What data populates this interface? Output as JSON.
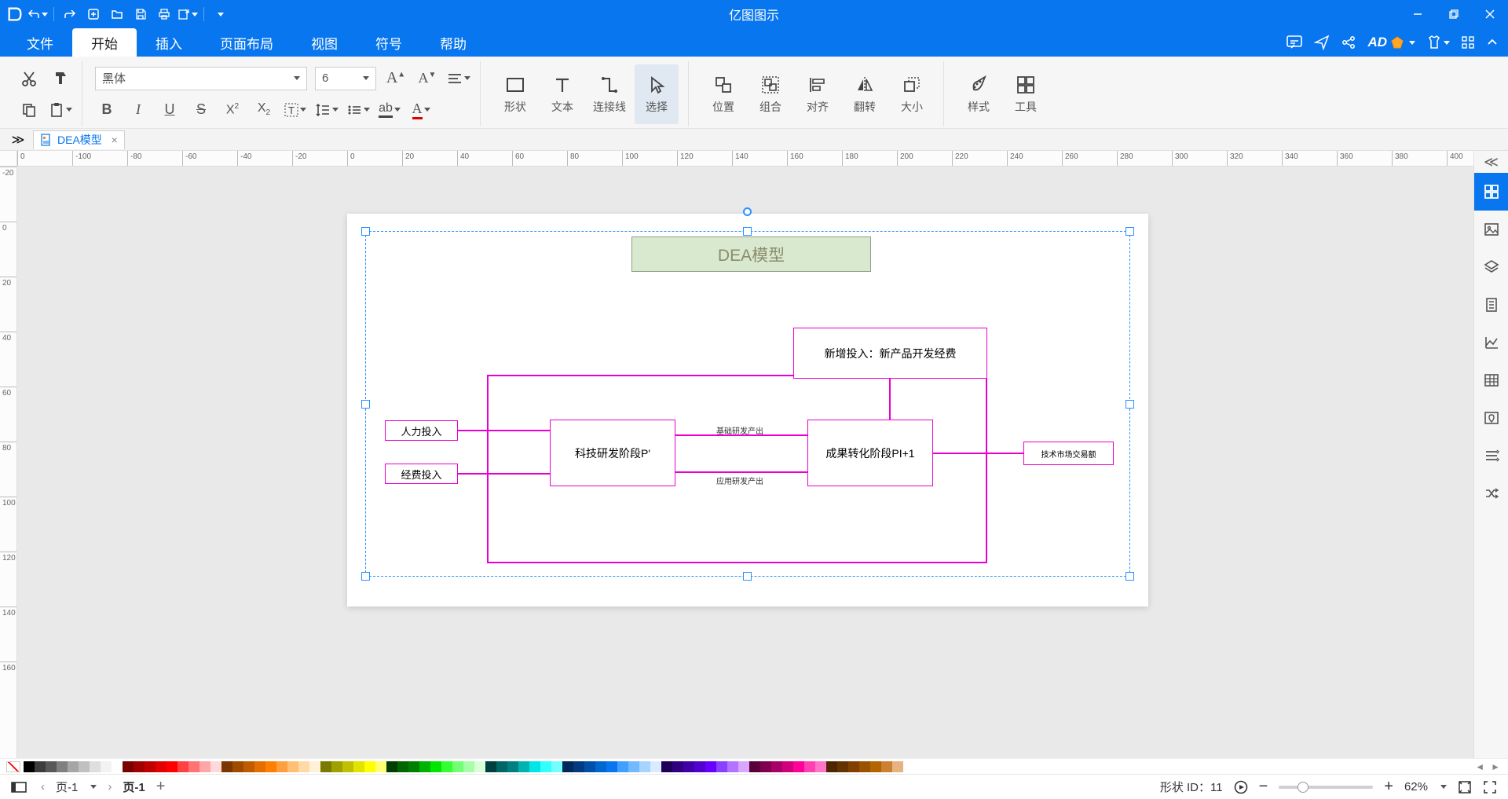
{
  "app": {
    "name": "亿图图示"
  },
  "menu": {
    "tabs": [
      "文件",
      "开始",
      "插入",
      "页面布局",
      "视图",
      "符号",
      "帮助"
    ],
    "active": 1,
    "ad": "AD"
  },
  "ribbon": {
    "font": "黑体",
    "size": "6",
    "groups": {
      "shape": "形状",
      "text": "文本",
      "connector": "连接线",
      "select": "选择",
      "position": "位置",
      "group": "组合",
      "align": "对齐",
      "flip": "翻转",
      "sizegrp": "大小",
      "style": "样式",
      "tools": "工具"
    }
  },
  "doctab": {
    "name": "DEA模型"
  },
  "hruler": [
    "0",
    "-100",
    "-80",
    "-60",
    "-40",
    "-20",
    "0",
    "20",
    "40",
    "60",
    "80",
    "100",
    "120",
    "140",
    "160",
    "180",
    "200",
    "220",
    "240",
    "260",
    "280",
    "300",
    "320",
    "340",
    "360",
    "380",
    "400"
  ],
  "vruler": [
    "-20",
    "0",
    "20",
    "40",
    "60",
    "80",
    "100",
    "120",
    "140",
    "160"
  ],
  "flow": {
    "title": "DEA模型",
    "in1": "人力投入",
    "in2": "经费投入",
    "stage1": "科技研发阶段P'",
    "stage2": "成果转化阶段PI+1",
    "top": "新增投入：新产品开发经费",
    "out": "技术市场交易额",
    "lab1": "基础研发产出",
    "lab2": "应用研发产出"
  },
  "rightpanel_icons": [
    "grid",
    "image",
    "layers",
    "page",
    "chart",
    "table",
    "map",
    "list",
    "shuffle"
  ],
  "status": {
    "page_label": "页-1",
    "page_active": "页-1",
    "shape": "形状 ID：",
    "shape_id": "11",
    "zoom": "62%"
  },
  "colors": [
    "#000000",
    "#3d3d3d",
    "#595959",
    "#808080",
    "#a6a6a6",
    "#c0c0c0",
    "#dedede",
    "#f2f2f2",
    "#ffffff",
    "#7a0000",
    "#a00000",
    "#c00000",
    "#e30000",
    "#ff0000",
    "#ff4040",
    "#ff7373",
    "#ffa6a6",
    "#ffd9d9",
    "#7a3800",
    "#a04a00",
    "#c05c00",
    "#e36f00",
    "#ff8000",
    "#ffa040",
    "#ffc073",
    "#ffd9a6",
    "#fff0d9",
    "#7a7a00",
    "#a0a000",
    "#c0c000",
    "#e3e300",
    "#ffff00",
    "#ffff73",
    "#003f00",
    "#006600",
    "#008000",
    "#00b300",
    "#00e600",
    "#33ff33",
    "#73ff73",
    "#a6ffa6",
    "#d9ffd9",
    "#004040",
    "#006666",
    "#008080",
    "#00b3b3",
    "#00e6e6",
    "#33ffff",
    "#73ffff",
    "#002859",
    "#003a80",
    "#0050a8",
    "#0066d0",
    "#0876ee",
    "#409fff",
    "#73b9ff",
    "#a6d3ff",
    "#d9ecff",
    "#1f0059",
    "#300080",
    "#4000a8",
    "#5200d0",
    "#6600ff",
    "#8c40ff",
    "#b273ff",
    "#d8a6ff",
    "#59003a",
    "#80004f",
    "#a80066",
    "#d0007d",
    "#ff0099",
    "#ff40b1",
    "#ff73c9",
    "#4d2600",
    "#663300",
    "#804000",
    "#995200",
    "#b36600",
    "#cc8033",
    "#e6b380"
  ]
}
